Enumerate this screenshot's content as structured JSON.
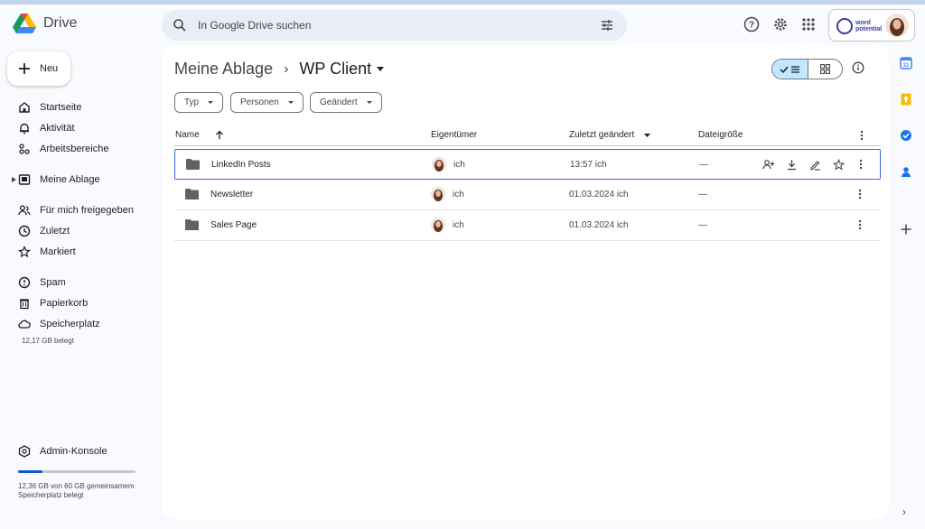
{
  "app": {
    "name": "Drive"
  },
  "search": {
    "placeholder": "In Google Drive suchen"
  },
  "sidebar": {
    "new_label": "Neu",
    "items": [
      {
        "label": "Startseite",
        "icon": "home-icon"
      },
      {
        "label": "Aktivität",
        "icon": "bell-icon"
      },
      {
        "label": "Arbeitsbereiche",
        "icon": "workspaces-icon"
      },
      {
        "label": "Meine Ablage",
        "icon": "my-drive-icon"
      },
      {
        "label": "Für mich freigegeben",
        "icon": "shared-icon"
      },
      {
        "label": "Zuletzt",
        "icon": "clock-icon"
      },
      {
        "label": "Markiert",
        "icon": "star-icon"
      },
      {
        "label": "Spam",
        "icon": "spam-icon"
      },
      {
        "label": "Papierkorb",
        "icon": "trash-icon"
      },
      {
        "label": "Speicherplatz",
        "icon": "cloud-icon"
      }
    ],
    "storage_used": "12,17 GB belegt",
    "admin_label": "Admin-Konsole",
    "quota_text": "12,36 GB von 60 GB gemeinsamem Speicherplatz belegt",
    "quota_fraction": 0.206
  },
  "breadcrumb": {
    "root": "Meine Ablage",
    "current": "WP Client"
  },
  "filters": [
    "Typ",
    "Personen",
    "Geändert"
  ],
  "table": {
    "headers": {
      "name": "Name",
      "owner": "Eigentümer",
      "modified": "Zuletzt geändert",
      "size": "Dateigröße"
    },
    "rows": [
      {
        "name": "LinkedIn Posts",
        "owner": "ich",
        "modified": "13:57 ich",
        "size": "—"
      },
      {
        "name": "Newsletter",
        "owner": "ich",
        "modified": "01.03.2024 ich",
        "size": "—"
      },
      {
        "name": "Sales Page",
        "owner": "ich",
        "modified": "01.03.2024 ich",
        "size": "—"
      }
    ]
  },
  "account": {
    "logo_line1": "word",
    "logo_line2": "potential"
  },
  "colors": {
    "accent": "#0b57d0",
    "selected_view": "#c2e7ff",
    "panel": "#ffffff",
    "background": "#f8fafd"
  }
}
